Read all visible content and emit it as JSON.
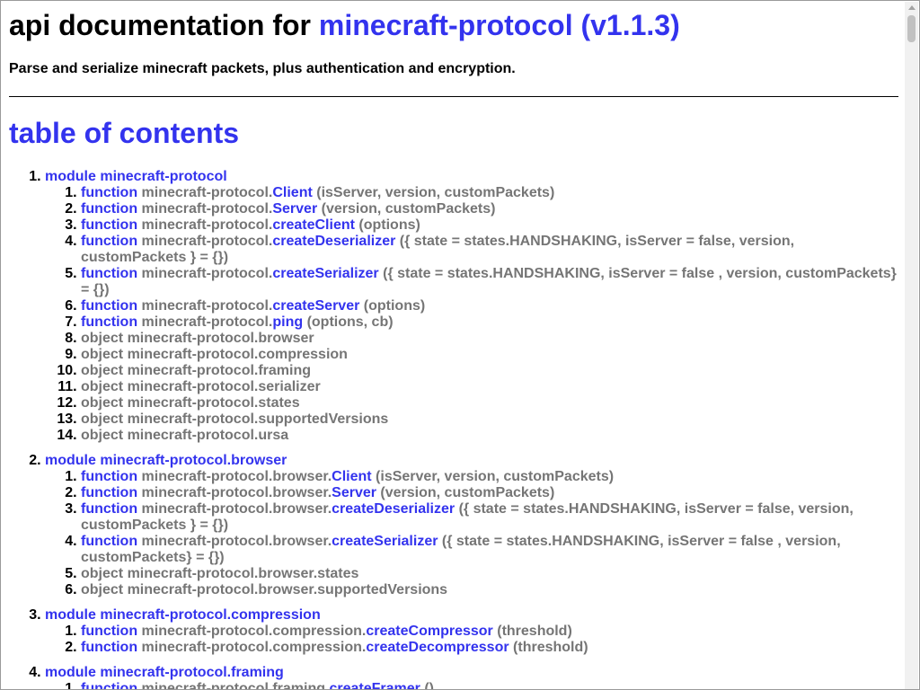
{
  "header": {
    "title_prefix": "api documentation for ",
    "title_link": "minecraft-protocol (v1.1.3)",
    "subtitle": "Parse and serialize minecraft packets, plus authentication and encryption."
  },
  "toc": {
    "heading": "table of contents",
    "modules": [
      {
        "label": "module minecraft-protocol",
        "items": [
          {
            "kind": "function",
            "qual": "minecraft-protocol.",
            "name": "Client",
            "args": "(isServer, version, customPackets)"
          },
          {
            "kind": "function",
            "qual": "minecraft-protocol.",
            "name": "Server",
            "args": "(version, customPackets)"
          },
          {
            "kind": "function",
            "qual": "minecraft-protocol.",
            "name": "createClient",
            "args": "(options)"
          },
          {
            "kind": "function",
            "qual": "minecraft-protocol.",
            "name": "createDeserializer",
            "args": "({ state = states.HANDSHAKING, isServer = false, version, customPackets } = {})"
          },
          {
            "kind": "function",
            "qual": "minecraft-protocol.",
            "name": "createSerializer",
            "args": "({ state = states.HANDSHAKING, isServer = false , version, customPackets} = {})"
          },
          {
            "kind": "function",
            "qual": "minecraft-protocol.",
            "name": "createServer",
            "args": "(options)"
          },
          {
            "kind": "function",
            "qual": "minecraft-protocol.",
            "name": "ping",
            "args": "(options, cb)"
          },
          {
            "kind": "object",
            "text": "object minecraft-protocol.browser"
          },
          {
            "kind": "object",
            "text": "object minecraft-protocol.compression"
          },
          {
            "kind": "object",
            "text": "object minecraft-protocol.framing"
          },
          {
            "kind": "object",
            "text": "object minecraft-protocol.serializer"
          },
          {
            "kind": "object",
            "text": "object minecraft-protocol.states"
          },
          {
            "kind": "object",
            "text": "object minecraft-protocol.supportedVersions"
          },
          {
            "kind": "object",
            "text": "object minecraft-protocol.ursa"
          }
        ]
      },
      {
        "label": "module minecraft-protocol.browser",
        "items": [
          {
            "kind": "function",
            "qual": "minecraft-protocol.browser.",
            "name": "Client",
            "args": "(isServer, version, customPackets)"
          },
          {
            "kind": "function",
            "qual": "minecraft-protocol.browser.",
            "name": "Server",
            "args": "(version, customPackets)"
          },
          {
            "kind": "function",
            "qual": "minecraft-protocol.browser.",
            "name": "createDeserializer",
            "args": "({ state = states.HANDSHAKING, isServer = false, version, customPackets } = {})"
          },
          {
            "kind": "function",
            "qual": "minecraft-protocol.browser.",
            "name": "createSerializer",
            "args": "({ state = states.HANDSHAKING, isServer = false , version, customPackets} = {})"
          },
          {
            "kind": "object",
            "text": "object minecraft-protocol.browser.states"
          },
          {
            "kind": "object",
            "text": "object minecraft-protocol.browser.supportedVersions"
          }
        ]
      },
      {
        "label": "module minecraft-protocol.compression",
        "items": [
          {
            "kind": "function",
            "qual": "minecraft-protocol.compression.",
            "name": "createCompressor",
            "args": "(threshold)"
          },
          {
            "kind": "function",
            "qual": "minecraft-protocol.compression.",
            "name": "createDecompressor",
            "args": "(threshold)"
          }
        ]
      },
      {
        "label": "module minecraft-protocol.framing",
        "items": [
          {
            "kind": "function",
            "qual": "minecraft-protocol.framing.",
            "name": "createFramer",
            "args": "()"
          }
        ]
      }
    ]
  },
  "keyword": "function"
}
